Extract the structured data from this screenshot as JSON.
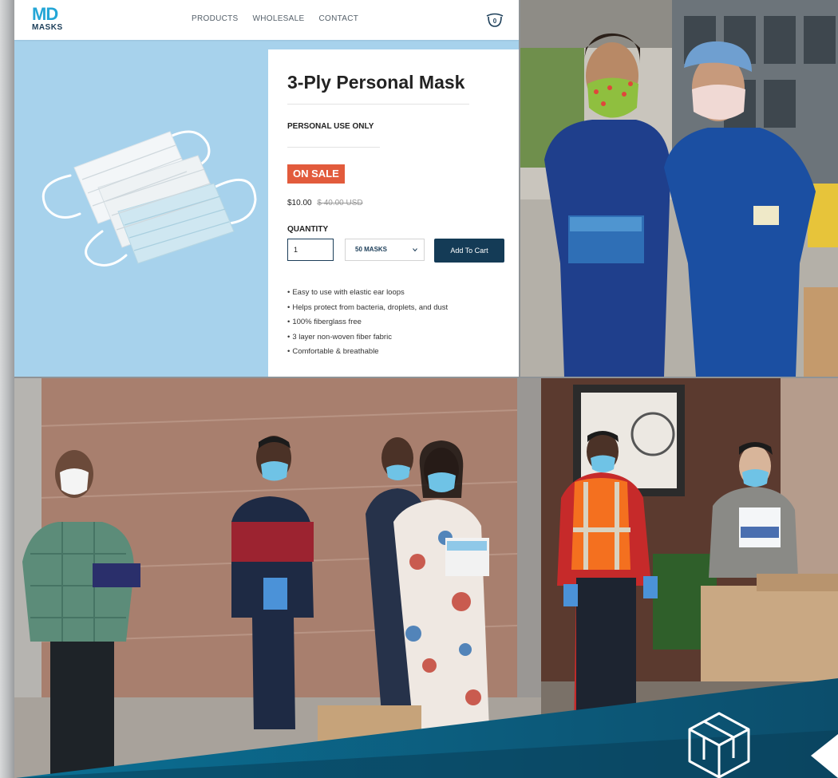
{
  "site": {
    "logo_md": "MD",
    "logo_masks": "MASKS",
    "nav": [
      "PRODUCTS",
      "WHOLESALE",
      "CONTACT"
    ],
    "cart_count": "0",
    "product": {
      "title": "3-Ply Personal Mask",
      "subtitle": "PERSONAL USE ONLY",
      "badge": "ON SALE",
      "price": "$10.00",
      "old_price": "$ 40.00 USD",
      "quantity_label": "QUANTITY",
      "quantity_value": "1",
      "pack_option": "50 MASKS",
      "add_to_cart": "Add To Cart",
      "features": [
        "Easy to use with elastic ear loops",
        "Helps protect from bacteria, droplets, and dust",
        "100% fiberglass free",
        "3 layer non-woven fiber fabric",
        "Comfortable & breathable"
      ]
    }
  },
  "colors": {
    "brand_light_blue": "#24a6d6",
    "brand_navy": "#143b56",
    "sale_red": "#e25b3c",
    "product_bg": "#a7d2ec",
    "banner_teal": "#0d5a7a"
  },
  "icons": [
    "cart-icon",
    "chevron-down-icon",
    "box-logo-icon",
    "next-arrow-icon"
  ]
}
